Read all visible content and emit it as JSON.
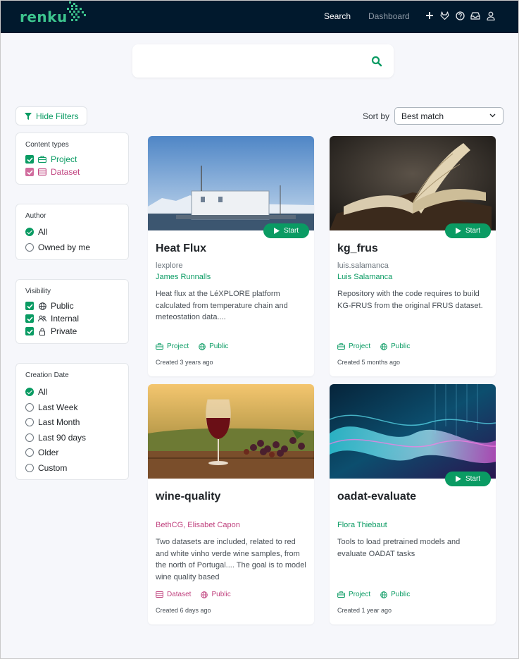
{
  "app": {
    "logo_text": "renku"
  },
  "nav": {
    "search": "Search",
    "dashboard": "Dashboard"
  },
  "search": {
    "value": "",
    "placeholder": ""
  },
  "filters": {
    "hide_label": "Hide Filters",
    "content_types": {
      "title": "Content types",
      "items": [
        {
          "label": "Project",
          "checked": true
        },
        {
          "label": "Dataset",
          "checked": true
        }
      ]
    },
    "author": {
      "title": "Author",
      "items": [
        {
          "label": "All",
          "selected": true
        },
        {
          "label": "Owned by me",
          "selected": false
        }
      ]
    },
    "visibility": {
      "title": "Visibility",
      "items": [
        {
          "label": "Public",
          "checked": true
        },
        {
          "label": "Internal",
          "checked": true
        },
        {
          "label": "Private",
          "checked": true
        }
      ]
    },
    "creation_date": {
      "title": "Creation Date",
      "items": [
        {
          "label": "All",
          "selected": true
        },
        {
          "label": "Last Week",
          "selected": false
        },
        {
          "label": "Last Month",
          "selected": false
        },
        {
          "label": "Last 90 days",
          "selected": false
        },
        {
          "label": "Older",
          "selected": false
        },
        {
          "label": "Custom",
          "selected": false
        }
      ]
    }
  },
  "sort": {
    "label": "Sort by",
    "selected": "Best match"
  },
  "cards": [
    {
      "title": "Heat Flux",
      "namespace": "lexplore",
      "author": "James Runnalls",
      "description": "Heat flux at the LéXPLORE platform calculated from temperature chain and meteostation data....",
      "type": "Project",
      "visibility": "Public",
      "created": "Created 3 years ago",
      "start": "Start"
    },
    {
      "title": "kg_frus",
      "namespace": "luis.salamanca",
      "author": "Luis Salamanca",
      "description": "Repository with the code requires to build KG-FRUS from the original FRUS dataset.",
      "type": "Project",
      "visibility": "Public",
      "created": "Created 5 months ago",
      "start": "Start"
    },
    {
      "title": "wine-quality",
      "namespace": "",
      "author": "BethCG, Elisabet Capon",
      "description": "Two datasets are included, related to red and white vinho verde wine samples, from the north of Portugal.... The goal is to model wine quality based",
      "type": "Dataset",
      "visibility": "Public",
      "created": "Created 6 days ago",
      "start": ""
    },
    {
      "title": "oadat-evaluate",
      "namespace": "",
      "author": "Flora Thiebaut",
      "description": "Tools to load pretrained models and evaluate OADAT tasks",
      "type": "Project",
      "visibility": "Public",
      "created": "Created 1 year ago",
      "start": "Start"
    }
  ],
  "colors": {
    "brand": "#0a9b63",
    "dataset": "#c0437f",
    "nav_bg": "#01192d"
  }
}
